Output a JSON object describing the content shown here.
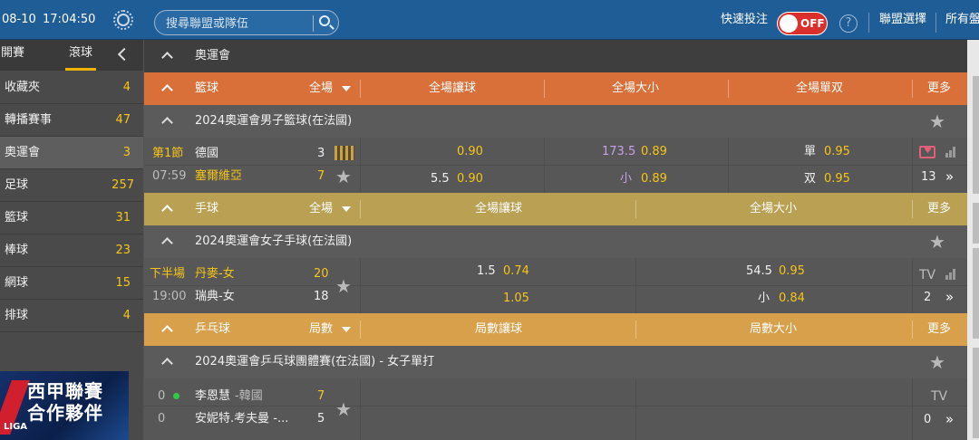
{
  "header": {
    "date": "08-10",
    "time": "17:04:50",
    "search_placeholder": "搜尋聯盟或隊伍",
    "quick_bet_label": "快速投注",
    "toggle_state": "OFF",
    "help_glyph": "?",
    "league_select_label": "聯盟選擇",
    "all_markets_label": "所有盤"
  },
  "sidebar": {
    "tabs": [
      "開賽",
      "滾球"
    ],
    "active_tab": "滾球",
    "items": [
      {
        "label": "收藏夾",
        "count": "4"
      },
      {
        "label": "轉播賽事",
        "count": "47"
      },
      {
        "label": "奧運會",
        "count": "3"
      },
      {
        "label": "足球",
        "count": "257"
      },
      {
        "label": "籃球",
        "count": "31"
      },
      {
        "label": "棒球",
        "count": "23"
      },
      {
        "label": "網球",
        "count": "15"
      },
      {
        "label": "排球",
        "count": "4"
      }
    ],
    "banner_line1": "西甲聯賽",
    "banner_line2": "合作夥伴",
    "banner_liga": "LIGA"
  },
  "main": {
    "section_title": "奧運會",
    "more_label": "更多",
    "basketball": {
      "sport": "籃球",
      "period": "全場",
      "cols": [
        "全場讓球",
        "全場大小",
        "全場單双"
      ],
      "color": "#d9703a",
      "league": "2024奧運會男子籃球(在法國)",
      "match": {
        "period": "第1節",
        "clock": "07:59",
        "home": "德國",
        "away": "塞爾維亞",
        "home_score": "3",
        "away_score": "7",
        "hcap_top_odds": "0.90",
        "hcap_line": "5.5",
        "hcap_bot_odds": "0.90",
        "ou_line": "173.5",
        "ou_top_odds": "0.89",
        "ou_small_label": "小",
        "ou_bot_odds": "0.89",
        "oe_odd_label": "單",
        "oe_odd_odds": "0.95",
        "oe_even_label": "双",
        "oe_even_odds": "0.95",
        "more_count": "13"
      }
    },
    "handball": {
      "sport": "手球",
      "period": "全場",
      "cols": [
        "全場讓球",
        "全場大小"
      ],
      "color": "#b9a052",
      "league": "2024奧運會女子手球(在法國)",
      "match": {
        "period": "下半場",
        "clock": "19:00",
        "home": "丹麥-女",
        "away": "瑞典-女",
        "home_score": "20",
        "away_score": "18",
        "hcap_line": "1.5",
        "hcap_top_odds": "0.74",
        "hcap_bot_odds": "1.05",
        "ou_line": "54.5",
        "ou_top_odds": "0.95",
        "ou_small_label": "小",
        "ou_bot_odds": "0.84",
        "tv_label": "TV",
        "more_count": "2"
      }
    },
    "tabletennis": {
      "sport": "乒乓球",
      "period": "局數",
      "cols": [
        "局數讓球",
        "局數大小"
      ],
      "color": "#d8a04a",
      "league": "2024奧運會乒乓球團體賽(在法國) - 女子單打",
      "match": {
        "home_sets": "0",
        "away_sets": "0",
        "home": "李恩慧",
        "home_country": "-韓國",
        "away": "安妮特.考夫曼 -...",
        "home_score": "7",
        "away_score": "5",
        "tv_label": "TV",
        "more_count": "0"
      }
    }
  }
}
